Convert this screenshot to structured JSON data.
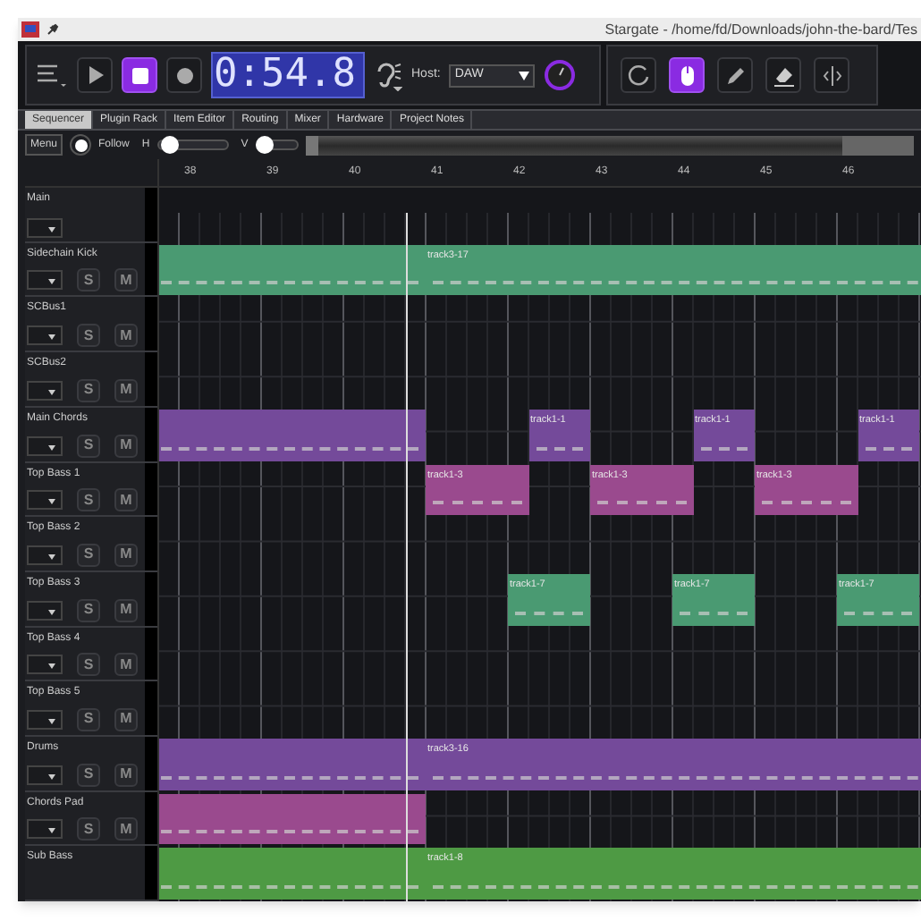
{
  "window": {
    "title": "Stargate - /home/fd/Downloads/john-the-bard/Tes"
  },
  "transport": {
    "buttons": [
      {
        "kind": "play",
        "selected": false
      },
      {
        "kind": "stop",
        "selected": true
      },
      {
        "kind": "record",
        "selected": false
      }
    ],
    "clock": "0:54.8",
    "host_label": "Host:",
    "host_value": "DAW"
  },
  "tools": [
    {
      "kind": "loop",
      "selected": false
    },
    {
      "kind": "mouse",
      "selected": true
    },
    {
      "kind": "pencil",
      "selected": false
    },
    {
      "kind": "eraser",
      "selected": false
    },
    {
      "kind": "split",
      "selected": false
    }
  ],
  "tabs": [
    {
      "label": "Sequencer",
      "selected": true
    },
    {
      "label": "Plugin Rack",
      "selected": false
    },
    {
      "label": "Item Editor",
      "selected": false
    },
    {
      "label": "Routing",
      "selected": false
    },
    {
      "label": "Mixer",
      "selected": false
    },
    {
      "label": "Hardware",
      "selected": false
    },
    {
      "label": "Project Notes",
      "selected": false
    }
  ],
  "controls": {
    "menu": "Menu",
    "follow": {
      "label": "Follow",
      "checked": true
    },
    "h": {
      "label": "H",
      "level": 0.1
    },
    "v": {
      "label": "V",
      "level": 0.1
    }
  },
  "ruler": [
    "38",
    "39",
    "40",
    "41",
    "42",
    "43",
    "44",
    "45",
    "46"
  ],
  "tracks": [
    {
      "name": "Main",
      "kind": "main"
    },
    {
      "name": "Sidechain Kick",
      "kind": "track",
      "solo": "S",
      "mute": "M",
      "clips": [
        {
          "color": "#4a9a72"
        },
        {
          "label": "track3-17",
          "color": "#4a9a72"
        }
      ]
    },
    {
      "name": "SCBus1",
      "kind": "track",
      "solo": "S",
      "mute": "M"
    },
    {
      "name": "SCBus2",
      "kind": "track",
      "solo": "S",
      "mute": "M"
    },
    {
      "name": "Main Chords",
      "kind": "track",
      "solo": "S",
      "mute": "M",
      "clips": [
        {
          "color": "#744a9a"
        },
        {
          "label": "track1-1",
          "color": "#744a9a"
        },
        {
          "label": "track1-1",
          "color": "#744a9a"
        },
        {
          "label": "track1-1",
          "color": "#744a9a"
        }
      ]
    },
    {
      "name": "Top Bass 1",
      "kind": "track",
      "solo": "S",
      "mute": "M",
      "clips": [
        {
          "label": "track1-3",
          "color": "#9a4a8e"
        },
        {
          "label": "track1-3",
          "color": "#9a4a8e"
        },
        {
          "label": "track1-3",
          "color": "#9a4a8e"
        }
      ]
    },
    {
      "name": "Top Bass 2",
      "kind": "track",
      "solo": "S",
      "mute": "M"
    },
    {
      "name": "Top Bass 3",
      "kind": "track",
      "solo": "S",
      "mute": "M",
      "clips": [
        {
          "label": "track1-7",
          "color": "#4a9a72"
        },
        {
          "label": "track1-7",
          "color": "#4a9a72"
        },
        {
          "label": "track1-7",
          "color": "#4a9a72"
        }
      ]
    },
    {
      "name": "Top Bass 4",
      "kind": "track",
      "solo": "S",
      "mute": "M"
    },
    {
      "name": "Top Bass 5",
      "kind": "track",
      "solo": "S",
      "mute": "M"
    },
    {
      "name": "Drums",
      "kind": "track",
      "solo": "S",
      "mute": "M",
      "clips": [
        {
          "color": "#744a9a"
        },
        {
          "label": "track3-16",
          "color": "#744a9a"
        }
      ]
    },
    {
      "name": "Chords Pad",
      "kind": "track",
      "solo": "S",
      "mute": "M",
      "clips": [
        {
          "color": "#9a4a8e"
        }
      ]
    },
    {
      "name": "Sub Bass",
      "kind": "cut",
      "clips": [
        {
          "color": "#4e9a44"
        },
        {
          "label": "track1-8",
          "color": "#4e9a44"
        }
      ]
    }
  ]
}
